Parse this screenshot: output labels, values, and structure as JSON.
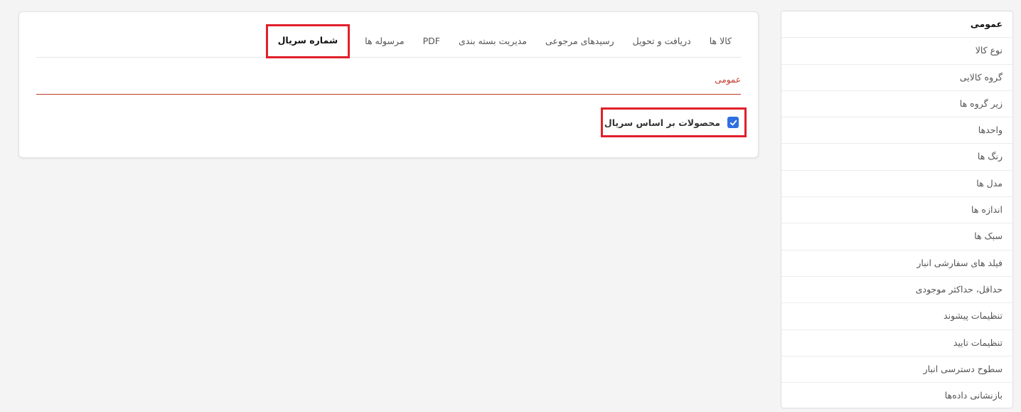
{
  "sidebar": {
    "items": [
      {
        "label": "عمومی",
        "active": true
      },
      {
        "label": "نوع کالا"
      },
      {
        "label": "گروه کالایی"
      },
      {
        "label": "زیر گروه ها"
      },
      {
        "label": "واحدها"
      },
      {
        "label": "رنگ ها"
      },
      {
        "label": "مدل ها"
      },
      {
        "label": "اندازه ها"
      },
      {
        "label": "سبک ها"
      },
      {
        "label": "فیلد های سفارشی انبار"
      },
      {
        "label": "حداقل، حداکثر موجودی"
      },
      {
        "label": "تنظیمات پیشوند"
      },
      {
        "label": "تنظیمات تایید"
      },
      {
        "label": "سطوح دسترسی انبار"
      },
      {
        "label": "بازنشانی داده‌ها"
      }
    ]
  },
  "tabs": [
    {
      "label": "کالا ها"
    },
    {
      "label": "دریافت و تحویل"
    },
    {
      "label": "رسیدهای مرجوعی"
    },
    {
      "label": "مدیریت بسته بندی"
    },
    {
      "label": "PDF"
    },
    {
      "label": "مرسوله ها"
    },
    {
      "label": "شماره سریال",
      "active": true
    }
  ],
  "section": {
    "label": "عمومی"
  },
  "serial_products": {
    "label": "محصولات بر اساس سریال",
    "checked": true
  },
  "colors": {
    "accent_red": "#e0202a",
    "section_red": "#c0392b",
    "checkbox_blue": "#2f6fe0"
  }
}
